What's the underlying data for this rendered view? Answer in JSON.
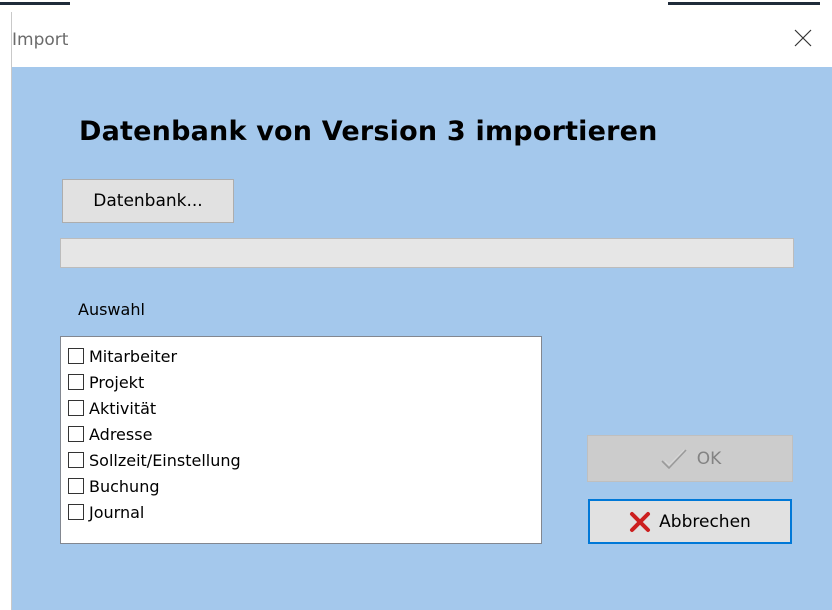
{
  "window": {
    "title": "Import",
    "close_icon": "close-icon"
  },
  "header": {
    "heading": "Datenbank von Version 3 importieren"
  },
  "actions": {
    "database_button": "Datenbank..."
  },
  "progress": {
    "value": 0
  },
  "selection": {
    "label": "Auswahl",
    "items": [
      {
        "label": "Mitarbeiter",
        "checked": false
      },
      {
        "label": "Projekt",
        "checked": false
      },
      {
        "label": "Aktivität",
        "checked": false
      },
      {
        "label": "Adresse",
        "checked": false
      },
      {
        "label": "Sollzeit/Einstellung",
        "checked": false
      },
      {
        "label": "Buchung",
        "checked": false
      },
      {
        "label": "Journal",
        "checked": false
      }
    ]
  },
  "footer": {
    "ok_label": "OK",
    "ok_icon": "checkmark-icon",
    "ok_enabled": false,
    "cancel_label": "Abbrechen",
    "cancel_icon": "red-x-icon"
  },
  "colors": {
    "window_background": "#a4c8ec",
    "cancel_border_accent": "#0078d7",
    "cancel_icon": "#cc1f1f"
  }
}
